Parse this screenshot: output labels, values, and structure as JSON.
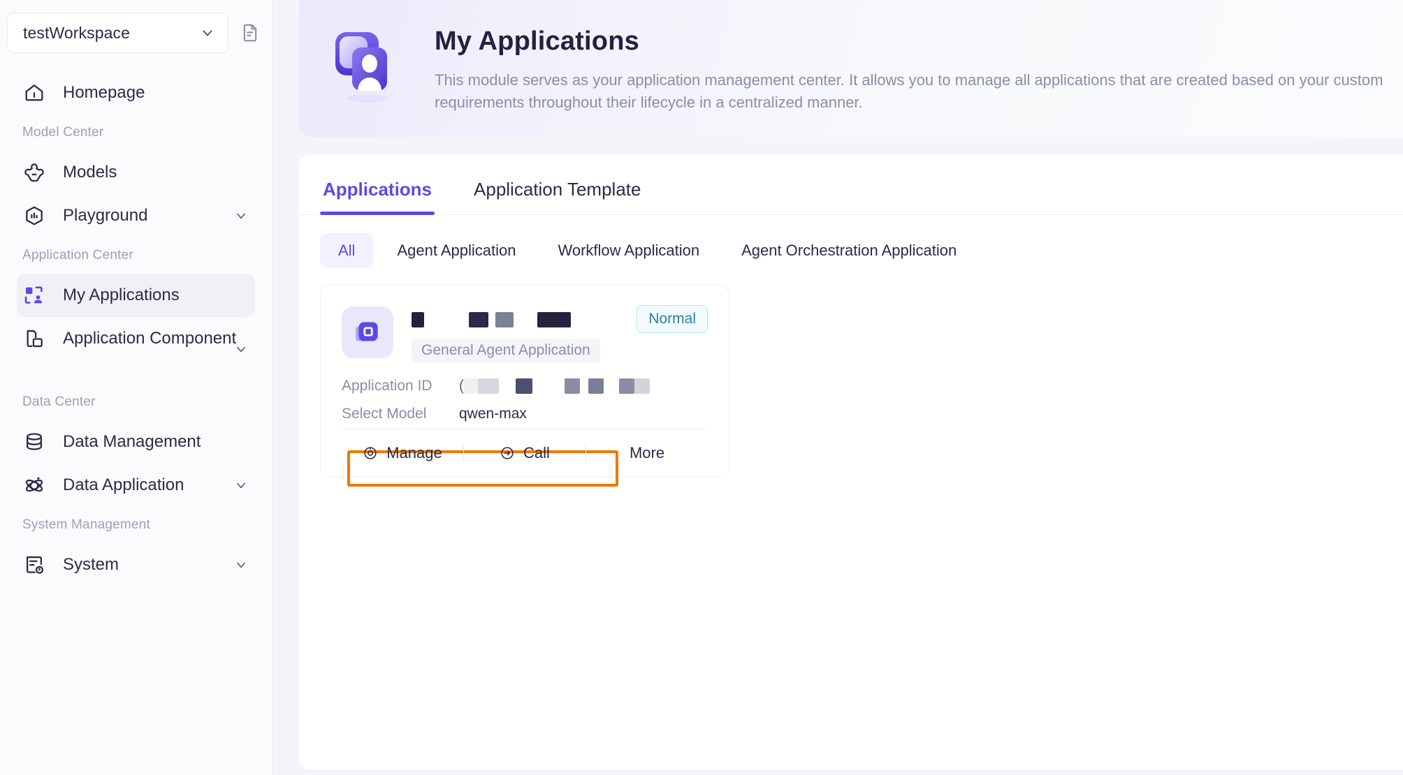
{
  "sidebar": {
    "workspace": {
      "name": "testWorkspace",
      "caret_icon": "chevron-down-icon",
      "doc_icon": "document-icon"
    },
    "nav": [
      {
        "type": "item",
        "label": "Homepage",
        "icon": "home-icon",
        "active": false,
        "expandable": false
      },
      {
        "type": "group",
        "label": "Model Center"
      },
      {
        "type": "item",
        "label": "Models",
        "icon": "models-icon",
        "active": false,
        "expandable": false
      },
      {
        "type": "item",
        "label": "Playground",
        "icon": "playground-icon",
        "active": false,
        "expandable": true
      },
      {
        "type": "group",
        "label": "Application Center"
      },
      {
        "type": "item",
        "label": "My Applications",
        "icon": "my-applications-icon",
        "active": true,
        "expandable": false
      },
      {
        "type": "item",
        "label": "Application Component",
        "icon": "application-component-icon",
        "active": false,
        "expandable": true
      },
      {
        "type": "group",
        "label": "Data Center"
      },
      {
        "type": "item",
        "label": "Data Management",
        "icon": "database-icon",
        "active": false,
        "expandable": false
      },
      {
        "type": "item",
        "label": "Data Application",
        "icon": "atom-icon",
        "active": false,
        "expandable": true
      },
      {
        "type": "group",
        "label": "System Management"
      },
      {
        "type": "item",
        "label": "System",
        "icon": "system-icon",
        "active": false,
        "expandable": true
      }
    ]
  },
  "hero": {
    "icon": "my-applications-hero-icon",
    "title": "My Applications",
    "description": "This module serves as your application management center. It allows you to manage all applications that are created based on your custom requirements throughout their lifecycle in a centralized manner."
  },
  "panel": {
    "tabs": [
      {
        "label": "Applications",
        "active": true
      },
      {
        "label": "Application Template",
        "active": false
      }
    ],
    "filters": [
      {
        "label": "All",
        "active": true
      },
      {
        "label": "Agent Application",
        "active": false
      },
      {
        "label": "Workflow Application",
        "active": false
      },
      {
        "label": "Agent Orchestration Application",
        "active": false
      }
    ],
    "cards": [
      {
        "avatar_icon": "app-square-icon",
        "title_redacted": true,
        "status": "Normal",
        "type_badge": "General Agent Application",
        "meta": [
          {
            "label": "Application ID",
            "value": "",
            "redacted": true,
            "highlighted": true
          },
          {
            "label": "Select Model",
            "value": "qwen-max",
            "redacted": false,
            "highlighted": false
          }
        ],
        "actions": [
          {
            "label": "Manage",
            "icon": "settings-target-icon"
          },
          {
            "label": "Call",
            "icon": "call-arrow-icon"
          },
          {
            "label": "More",
            "icon": ""
          }
        ]
      }
    ]
  },
  "colors": {
    "accent": "#5b4ae8",
    "highlight_box": "#f07800",
    "status_border": "#b6e3f5",
    "status_text": "#2f7f9e",
    "text_primary": "#2b2b48",
    "text_muted": "#8a8ea6",
    "sidebar_bg": "#fbfbfd",
    "main_bg": "#f4f5f9"
  }
}
